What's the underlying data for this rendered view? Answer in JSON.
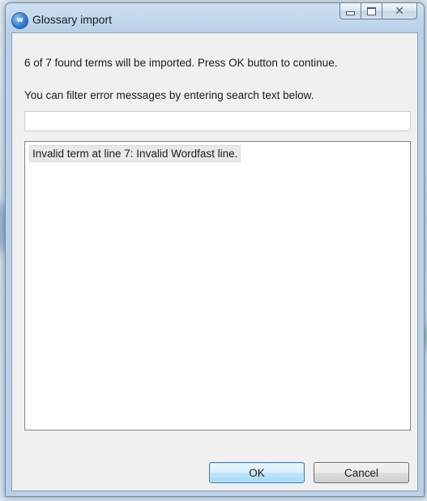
{
  "window": {
    "title": "Glossary import",
    "icon": "app-logo-icon",
    "caption_buttons": [
      "minimize-icon",
      "maximize-icon",
      "close-icon"
    ]
  },
  "dialog": {
    "summary_text": "6 of 7 found terms will be imported. Press OK button to continue.",
    "filter_hint": "You can filter error messages by entering search text below.",
    "search": {
      "value": "",
      "placeholder": ""
    },
    "errors": [
      "Invalid term at line 7: Invalid Wordfast line."
    ]
  },
  "buttons": {
    "ok_label": "OK",
    "cancel_label": "Cancel"
  },
  "colors": {
    "default_button_border": "#3c7fb1",
    "dialog_background": "#f0f0f0"
  }
}
